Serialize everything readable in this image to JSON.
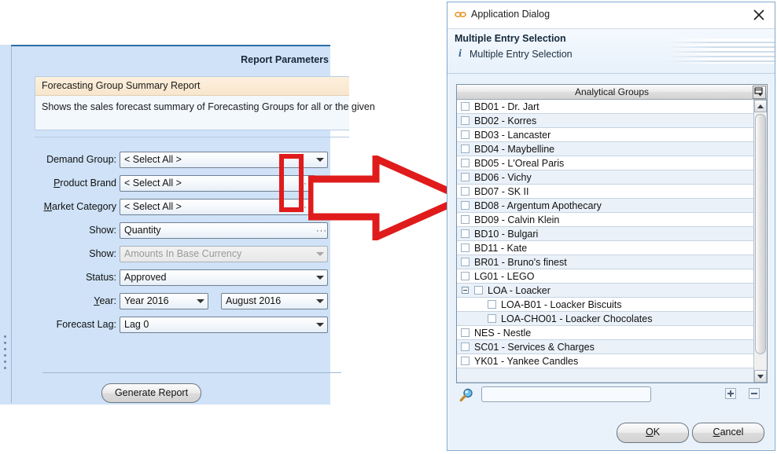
{
  "left_panel": {
    "page_title": "Report Parameters",
    "card": {
      "header": "Forecasting Group Summary Report",
      "description": "Shows the sales forecast summary of Forecasting Groups for all or the given"
    },
    "fields": [
      {
        "label": "Demand Group:",
        "value": "< Select All >",
        "type": "dropdown",
        "disabled": false,
        "has_plus": false
      },
      {
        "label": "Product Brand",
        "value": "< Select All >",
        "type": "dropdown-ellipsis",
        "disabled": false,
        "has_plus": true
      },
      {
        "label": "Market Category",
        "value": "< Select All >",
        "type": "dropdown-ellipsis",
        "disabled": false,
        "has_plus": true
      },
      {
        "label": "Show:",
        "value": "Quantity",
        "type": "dropdown-ellipsis",
        "disabled": false,
        "has_plus": false
      },
      {
        "label": "Show:",
        "value": "Amounts In Base Currency",
        "type": "dropdown",
        "disabled": true,
        "has_plus": false
      },
      {
        "label": "Status:",
        "value": "Approved",
        "type": "dropdown",
        "disabled": false,
        "has_plus": false
      },
      {
        "label": "Year:",
        "value": "Year 2016",
        "value2": "August 2016",
        "type": "dropdown-pair",
        "disabled": false,
        "has_plus": false
      },
      {
        "label": "Forecast Lag:",
        "value": "Lag 0",
        "type": "dropdown",
        "disabled": false,
        "has_plus": false
      }
    ],
    "generate_button": "Generate Report"
  },
  "dialog": {
    "window_title": "Application Dialog",
    "heading": "Multiple Entry Selection",
    "subheading": "Multiple Entry Selection",
    "list_header": "Analytical Groups",
    "rows": [
      {
        "label": "BD01 - Dr. Jart",
        "indent": 0,
        "checked": false,
        "tree": false
      },
      {
        "label": "BD02 - Korres",
        "indent": 0,
        "checked": false,
        "tree": false
      },
      {
        "label": "BD03 - Lancaster",
        "indent": 0,
        "checked": false,
        "tree": false
      },
      {
        "label": "BD04 - Maybelline",
        "indent": 0,
        "checked": false,
        "tree": false
      },
      {
        "label": "BD05 - L'Oreal Paris",
        "indent": 0,
        "checked": false,
        "tree": false
      },
      {
        "label": "BD06 - Vichy",
        "indent": 0,
        "checked": false,
        "tree": false
      },
      {
        "label": "BD07 - SK II",
        "indent": 0,
        "checked": false,
        "tree": false
      },
      {
        "label": "BD08 - Argentum Apothecary",
        "indent": 0,
        "checked": false,
        "tree": false
      },
      {
        "label": "BD09 - Calvin Klein",
        "indent": 0,
        "checked": false,
        "tree": false
      },
      {
        "label": "BD10 - Bulgari",
        "indent": 0,
        "checked": false,
        "tree": false
      },
      {
        "label": "BD11 - Kate",
        "indent": 0,
        "checked": false,
        "tree": false
      },
      {
        "label": "BR01 - Bruno's finest",
        "indent": 0,
        "checked": false,
        "tree": false
      },
      {
        "label": "LG01 - LEGO",
        "indent": 0,
        "checked": false,
        "tree": false
      },
      {
        "label": "LOA - Loacker",
        "indent": 1,
        "checked": false,
        "tree": true
      },
      {
        "label": "LOA-B01 - Loacker Biscuits",
        "indent": 2,
        "checked": false,
        "tree": false
      },
      {
        "label": "LOA-CHO01 - Loacker Chocolates",
        "indent": 2,
        "checked": false,
        "tree": false
      },
      {
        "label": "NES - Nestle",
        "indent": 0,
        "checked": false,
        "tree": false
      },
      {
        "label": "SC01 - Services & Charges",
        "indent": 0,
        "checked": false,
        "tree": false
      },
      {
        "label": "YK01 - Yankee Candles",
        "indent": 0,
        "checked": false,
        "tree": false
      }
    ],
    "search_value": "",
    "search_placeholder": "",
    "ok_label_pre": "",
    "ok_label_u": "O",
    "ok_label_post": "K",
    "cancel_label_u": "C",
    "cancel_label_post": "ancel"
  },
  "colors": {
    "panel_background": "#cfe2f7",
    "dialog_background": "#e9f2fb",
    "callout_red": "#e01b1b",
    "row_alt": "#eaf1f9",
    "card_header": "#fbeedd"
  }
}
